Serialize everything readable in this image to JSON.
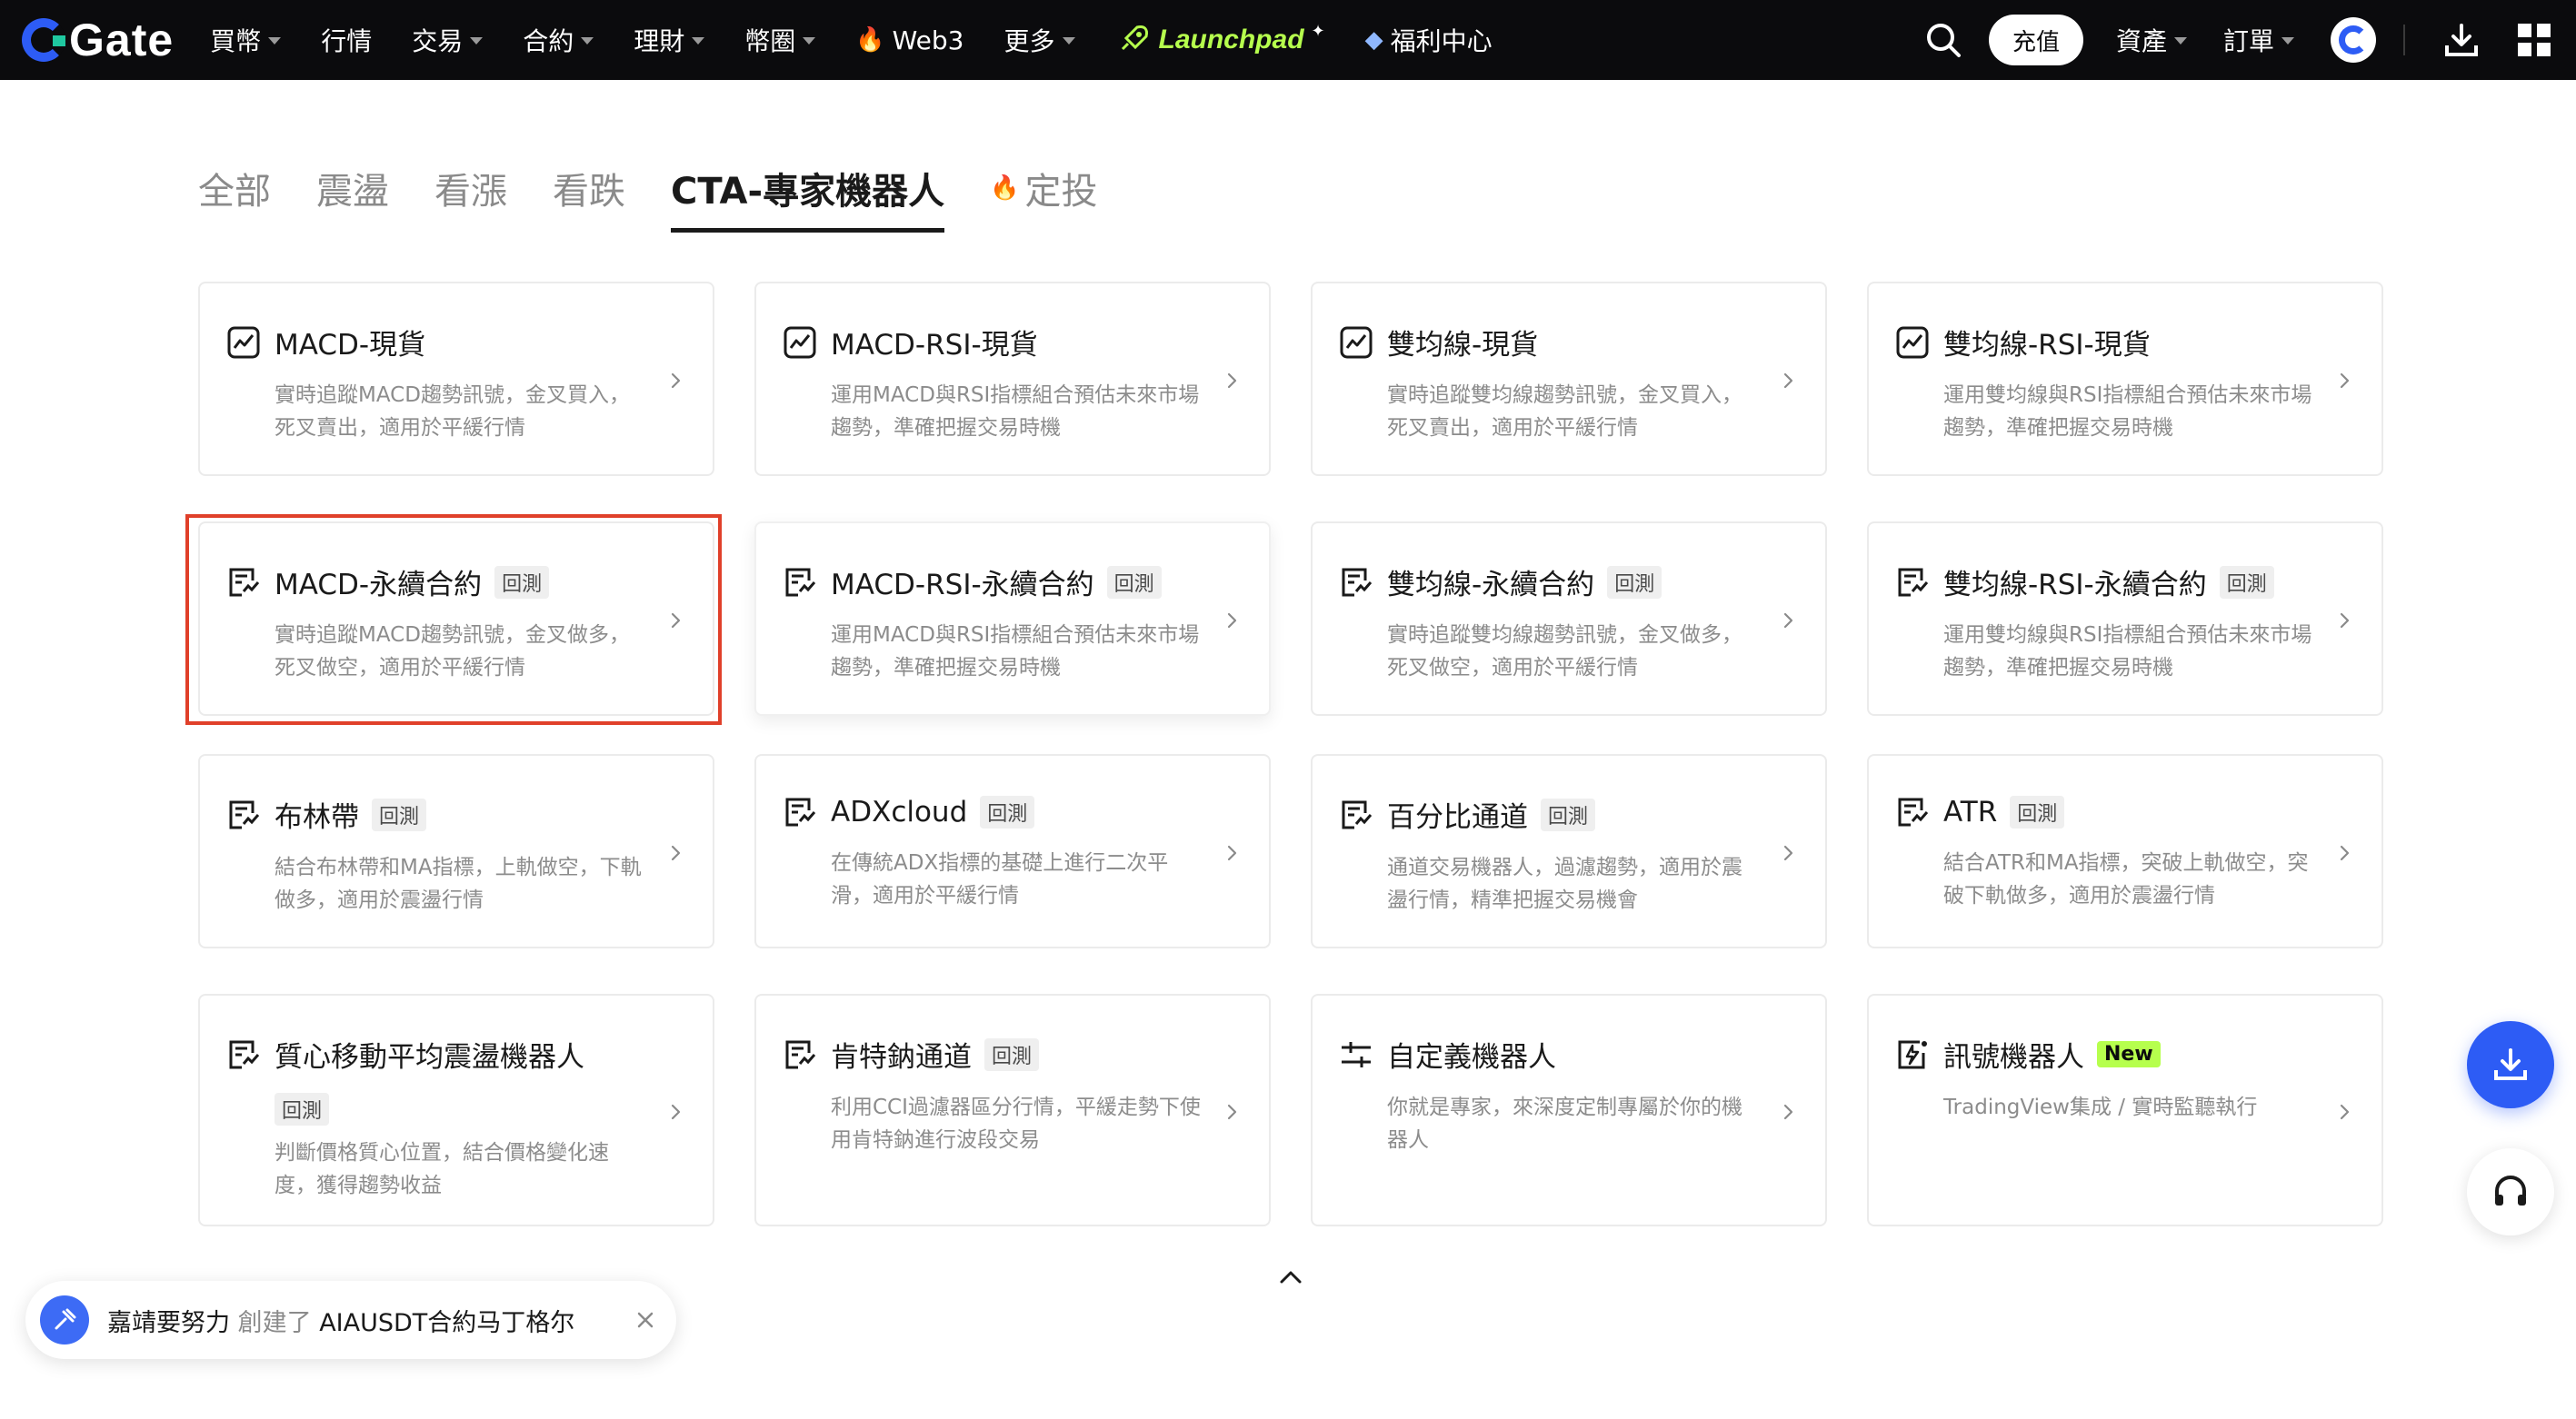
{
  "brand": {
    "name": "Gate",
    "accent": "#2d5cf5"
  },
  "nav": {
    "items": [
      {
        "label": "買幣",
        "caret": true
      },
      {
        "label": "行情",
        "caret": false
      },
      {
        "label": "交易",
        "caret": true
      },
      {
        "label": "合約",
        "caret": true
      },
      {
        "label": "理財",
        "caret": true
      },
      {
        "label": "幣圈",
        "caret": true
      }
    ],
    "web3": "Web3",
    "more": "更多",
    "launchpad": "Launchpad",
    "welfare": "福利中心",
    "deposit": "充值",
    "assets": "資產",
    "orders": "訂單"
  },
  "tabs": [
    "全部",
    "震盪",
    "看漲",
    "看跌",
    "CTA-專家機器人",
    "定投"
  ],
  "active_tab": "CTA-專家機器人",
  "cards": [
    {
      "title": "MACD-現貨",
      "badge": "",
      "desc": "實時追蹤MACD趨勢訊號，金叉買入，死叉賣出，適用於平緩行情",
      "icon": "chart-trend-icon"
    },
    {
      "title": "MACD-RSI-現貨",
      "badge": "",
      "desc": "運用MACD與RSI指標組合預估未來市場趨勢，準確把握交易時機",
      "icon": "chart-trend-icon"
    },
    {
      "title": "雙均線-現貨",
      "badge": "",
      "desc": "實時追蹤雙均線趨勢訊號，金叉買入，死叉賣出，適用於平緩行情",
      "icon": "chart-trend-icon"
    },
    {
      "title": "雙均線-RSI-現貨",
      "badge": "",
      "desc": "運用雙均線與RSI指標組合預估未來市場趨勢，準確把握交易時機",
      "icon": "chart-trend-icon"
    },
    {
      "title": "MACD-永續合約",
      "badge": "回測",
      "desc": "實時追蹤MACD趨勢訊號，金叉做多，死叉做空，適用於平緩行情",
      "icon": "contract-doc-icon"
    },
    {
      "title": "MACD-RSI-永續合約",
      "badge": "回測",
      "desc": "運用MACD與RSI指標組合預估未來市場趨勢，準確把握交易時機",
      "icon": "contract-doc-icon"
    },
    {
      "title": "雙均線-永續合約",
      "badge": "回測",
      "desc": "實時追蹤雙均線趨勢訊號，金叉做多，死叉做空，適用於平緩行情",
      "icon": "contract-doc-icon"
    },
    {
      "title": "雙均線-RSI-永續合約",
      "badge": "回測",
      "desc": "運用雙均線與RSI指標組合預估未來市場趨勢，準確把握交易時機",
      "icon": "contract-doc-icon"
    },
    {
      "title": "布林帶",
      "badge": "回測",
      "desc": "結合布林帶和MA指標，上軌做空，下軌做多，適用於震盪行情",
      "icon": "contract-doc-icon"
    },
    {
      "title": "ADXcloud",
      "badge": "回測",
      "desc": "在傳統ADX指標的基礎上進行二次平滑，適用於平緩行情",
      "icon": "contract-doc-icon"
    },
    {
      "title": "百分比通道",
      "badge": "回測",
      "desc": "通道交易機器人，過濾趨勢，適用於震盪行情，精準把握交易機會",
      "icon": "contract-doc-icon"
    },
    {
      "title": "ATR",
      "badge": "回測",
      "desc": "結合ATR和MA指標，突破上軌做空，突破下軌做多，適用於震盪行情",
      "icon": "contract-doc-icon"
    },
    {
      "title": "質心移動平均震盪機器人",
      "badge": "回測",
      "desc": "判斷價格質心位置，結合價格變化速度，獲得趨勢收益",
      "icon": "contract-doc-icon"
    },
    {
      "title": "肯特鈉通道",
      "badge": "回測",
      "desc": "利用CCI過濾器區分行情，平緩走勢下使用肯特鈉進行波段交易",
      "icon": "contract-doc-icon"
    },
    {
      "title": "自定義機器人",
      "badge": "",
      "desc": "你就是專家，來深度定制專屬於你的機器人",
      "icon": "sliders-icon"
    },
    {
      "title": "訊號機器人",
      "badge": "New",
      "desc": "TradingView集成 / 實時監聽執行",
      "icon": "signal-doc-icon"
    }
  ],
  "toast": {
    "user": "嘉靖要努力",
    "action": "創建了",
    "item": "AIAUSDT合約马丁格尔"
  }
}
